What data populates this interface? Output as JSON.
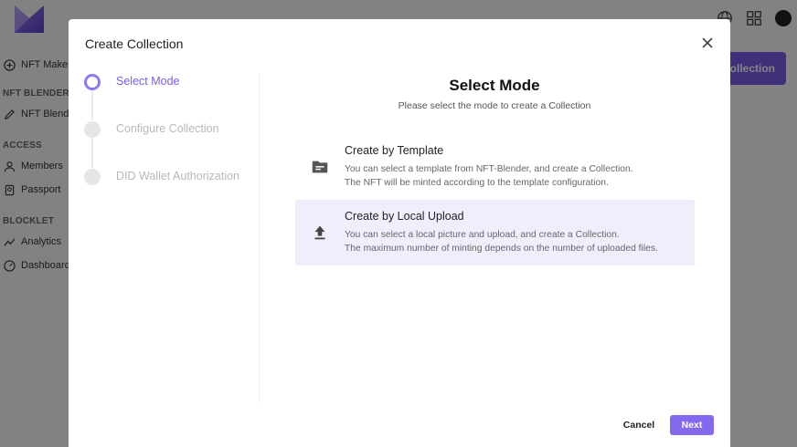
{
  "app": {
    "sidebar": {
      "top_item": "NFT Maker",
      "sections": [
        {
          "heading": "NFT BLENDER",
          "items": [
            "NFT Blender"
          ]
        },
        {
          "heading": "ACCESS",
          "items": [
            "Members",
            "Passport"
          ]
        },
        {
          "heading": "BLOCKLET",
          "items": [
            "Analytics",
            "Dashboard"
          ]
        }
      ]
    },
    "header_button": "Create Collection",
    "header_icons": [
      "globe-icon",
      "apps-grid-icon",
      "user-avatar"
    ]
  },
  "modal": {
    "title": "Create Collection",
    "close_icon": "close-icon",
    "steps": [
      {
        "label": "Select Mode",
        "active": true
      },
      {
        "label": "Configure Collection",
        "active": false
      },
      {
        "label": "DID Wallet Authorization",
        "active": false
      }
    ],
    "content": {
      "title": "Select Mode",
      "subtitle": "Please select the mode to create a Collection",
      "options": [
        {
          "icon": "folder-icon",
          "title": "Create by Template",
          "desc1": "You can select a template from NFT-Blender, and create a Collection.",
          "desc2": "The NFT will be minted according to the template configuration.",
          "selected": false
        },
        {
          "icon": "upload-icon",
          "title": "Create by Local Upload",
          "desc1": "You can select a local picture and upload, and create a Collection.",
          "desc2": "The maximum number of minting depends on the number of uploaded files.",
          "selected": true
        }
      ]
    },
    "buttons": {
      "cancel": "Cancel",
      "next": "Next"
    }
  },
  "colors": {
    "accent": "#7c5ce8",
    "selected_bg": "#f0edfd"
  }
}
